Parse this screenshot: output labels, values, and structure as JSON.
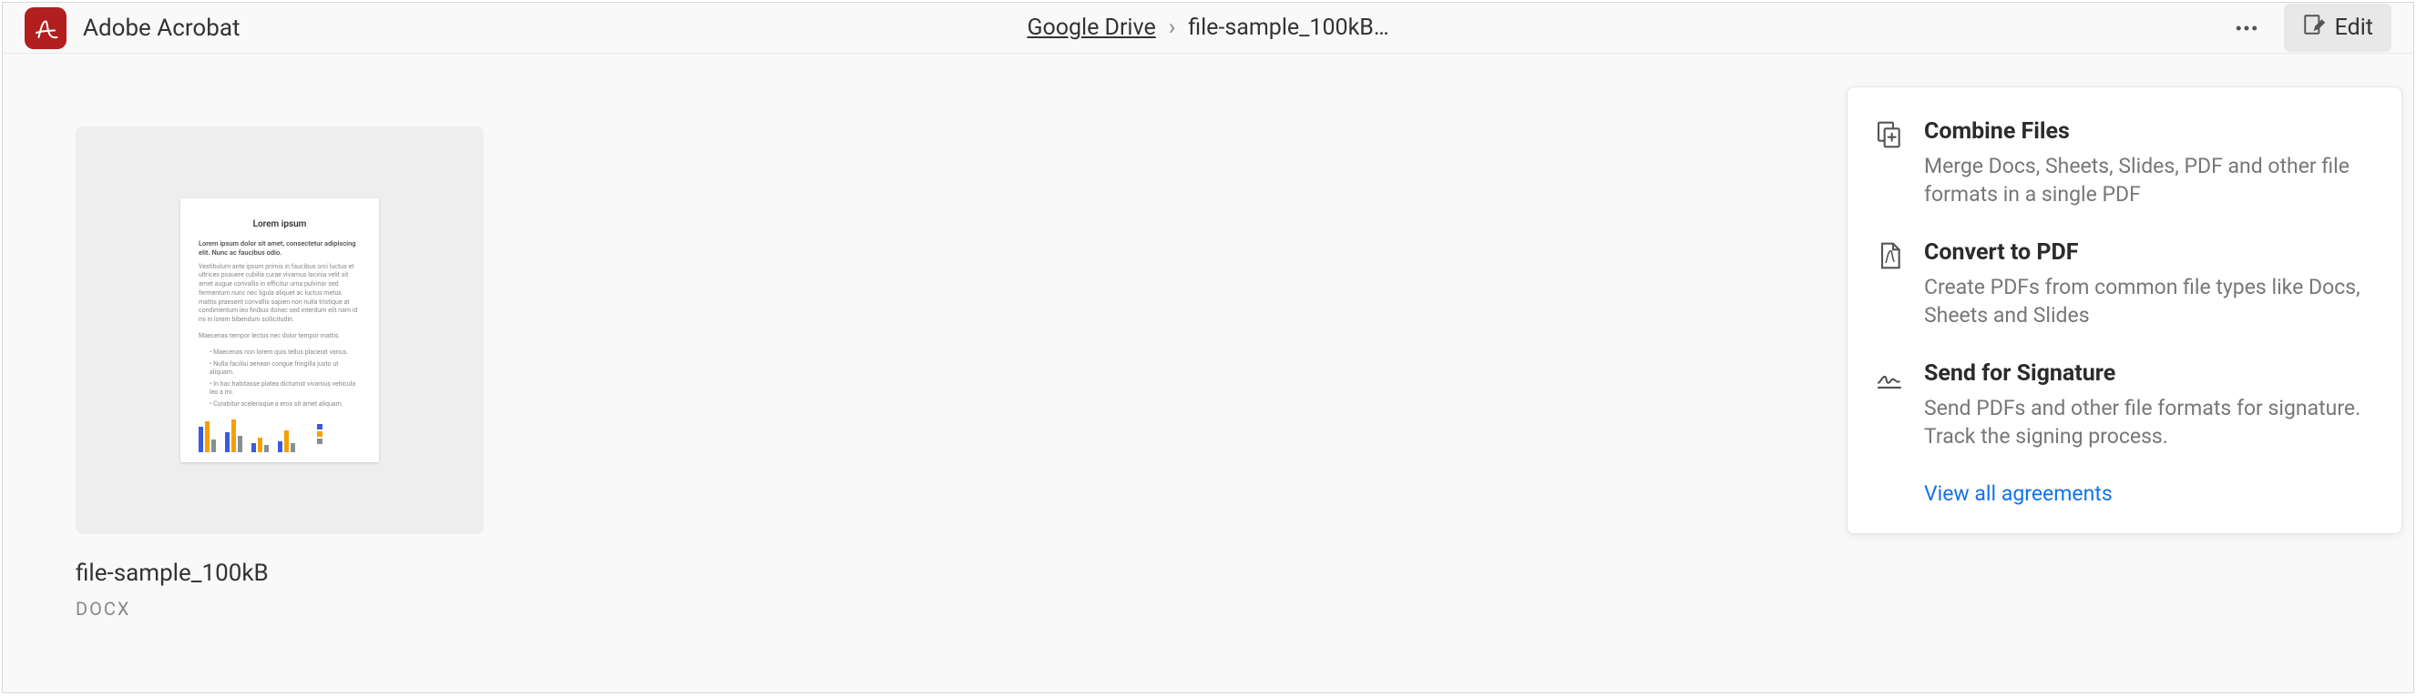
{
  "app": {
    "title": "Adobe Acrobat"
  },
  "breadcrumb": {
    "root": "Google Drive",
    "separator": "›",
    "current": "file-sample_100kB…"
  },
  "header": {
    "edit_label": "Edit"
  },
  "file": {
    "name": "file-sample_100kB",
    "type": "docx",
    "thumb": {
      "title": "Lorem ipsum",
      "subtitle": "Lorem ipsum dolor sit amet, consectetur adipiscing elit. Nunc ac faucibus odio."
    }
  },
  "panel": {
    "items": [
      {
        "icon": "combine-icon",
        "title": "Combine Files",
        "desc": "Merge Docs, Sheets, Slides, PDF and other file formats in a single PDF"
      },
      {
        "icon": "pdf-icon",
        "title": "Convert to PDF",
        "desc": "Create PDFs from common file types like Docs, Sheets and Slides"
      },
      {
        "icon": "signature-icon",
        "title": "Send for Signature",
        "desc": "Send PDFs and other file formats for signature. Track the signing process."
      }
    ],
    "link": "View all agreements"
  }
}
